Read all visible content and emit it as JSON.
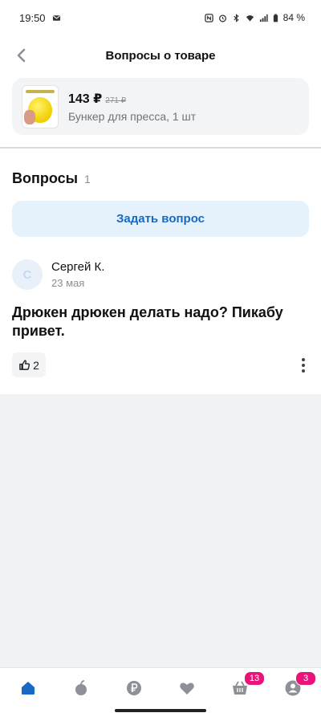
{
  "status_bar": {
    "time": "19:50",
    "battery": "84 %"
  },
  "header": {
    "title": "Вопросы о товаре"
  },
  "product": {
    "price": "143 ₽",
    "old_price": "271 ₽",
    "name": "Бункер для пресса, 1 шт"
  },
  "section": {
    "title": "Вопросы",
    "count": "1",
    "ask_button": "Задать вопрос"
  },
  "question": {
    "avatar_letter": "С",
    "author": "Сергей К.",
    "date": "23 мая",
    "text": "Дрюкен дрюкен делать надо? Пикабу привет.",
    "likes": "2"
  },
  "bottom_nav": {
    "items": [
      {
        "icon": "home-icon",
        "badge": null
      },
      {
        "icon": "fruit-icon",
        "badge": null
      },
      {
        "icon": "ruble-coin-icon",
        "badge": null
      },
      {
        "icon": "heart-icon",
        "badge": null
      },
      {
        "icon": "basket-icon",
        "badge": "13"
      },
      {
        "icon": "profile-icon",
        "badge": "3"
      }
    ]
  },
  "colors": {
    "accent": "#1869c4",
    "ask_bg": "#e6f2fb",
    "badge": "#e8147a",
    "nav_active": "#1869c4"
  }
}
